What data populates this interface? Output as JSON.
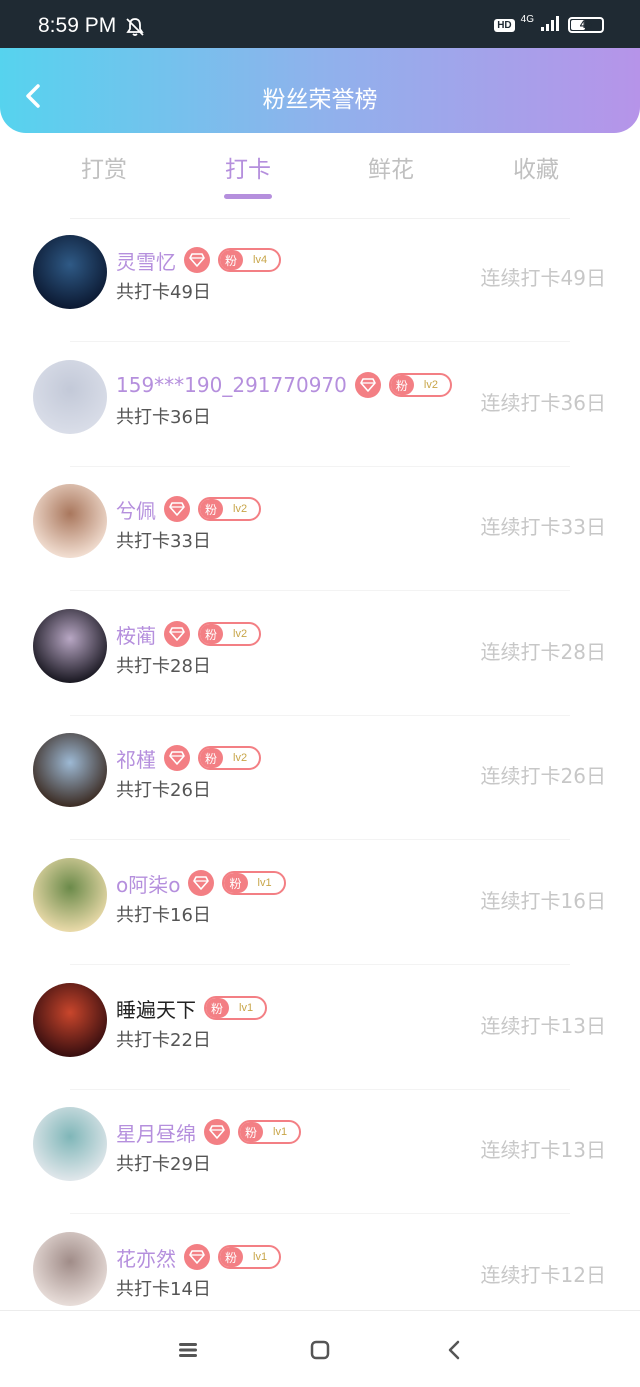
{
  "status_bar": {
    "time": "8:59 PM",
    "hd": "HD",
    "network": "4G",
    "battery": "46",
    "battery_level": 0.46,
    "icons": [
      "bell-muted-icon",
      "signal-icon",
      "battery-icon"
    ]
  },
  "header": {
    "title": "粉丝荣誉榜",
    "back_icon": "chevron-left-icon",
    "gradient": [
      "#56d3ee",
      "#b694e9"
    ]
  },
  "tabs": [
    {
      "label": "打赏",
      "active": false
    },
    {
      "label": "打卡",
      "active": true
    },
    {
      "label": "鲜花",
      "active": false
    },
    {
      "label": "收藏",
      "active": false
    }
  ],
  "fans": [
    {
      "name": "灵雪忆",
      "diamond": true,
      "fan_char": "粉",
      "level": "lv4",
      "total": "共打卡49日",
      "streak": "连续打卡49日",
      "avatar_colors": [
        "#0c1a33",
        "#2f5a86"
      ]
    },
    {
      "name": "159***190_291770970",
      "diamond": true,
      "fan_char": "粉",
      "level": "lv2",
      "total": "共打卡36日",
      "streak": "连续打卡36日",
      "avatar_colors": [
        "#d9dde8",
        "#c3c9d8"
      ]
    },
    {
      "name": "兮佩",
      "diamond": true,
      "fan_char": "粉",
      "level": "lv2",
      "total": "共打卡33日",
      "streak": "连续打卡33日",
      "avatar_colors": [
        "#f1ddd0",
        "#a9775d"
      ]
    },
    {
      "name": "桉蔺",
      "diamond": true,
      "fan_char": "粉",
      "level": "lv2",
      "total": "共打卡28日",
      "streak": "连续打卡28日",
      "avatar_colors": [
        "#1c1a24",
        "#b8a7c4"
      ]
    },
    {
      "name": "祁槿",
      "diamond": true,
      "fan_char": "粉",
      "level": "lv2",
      "total": "共打卡26日",
      "streak": "连续打卡26日",
      "avatar_colors": [
        "#3d2e26",
        "#9db9d4"
      ]
    },
    {
      "name": "o阿柒o",
      "diamond": true,
      "fan_char": "粉",
      "level": "lv1",
      "total": "共打卡16日",
      "streak": "连续打卡16日",
      "avatar_colors": [
        "#e8d9a8",
        "#6b8a4a"
      ]
    },
    {
      "name": "睡遍天下",
      "diamond": false,
      "fan_char": "粉",
      "level": "lv1",
      "total": "共打卡22日",
      "streak": "连续打卡13日",
      "avatar_colors": [
        "#3a0f10",
        "#c9462c"
      ]
    },
    {
      "name": "星月昼绵",
      "diamond": true,
      "fan_char": "粉",
      "level": "lv1",
      "total": "共打卡29日",
      "streak": "连续打卡13日",
      "avatar_colors": [
        "#dfe6ea",
        "#7fb6b8"
      ]
    },
    {
      "name": "花亦然",
      "diamond": true,
      "fan_char": "粉",
      "level": "lv1",
      "total": "共打卡14日",
      "streak": "连续打卡12日",
      "avatar_colors": [
        "#e7dcd8",
        "#a08c88"
      ]
    }
  ],
  "bottom_nav": {
    "icons": [
      "menu-icon",
      "home-square-icon",
      "back-triangle-icon"
    ]
  }
}
